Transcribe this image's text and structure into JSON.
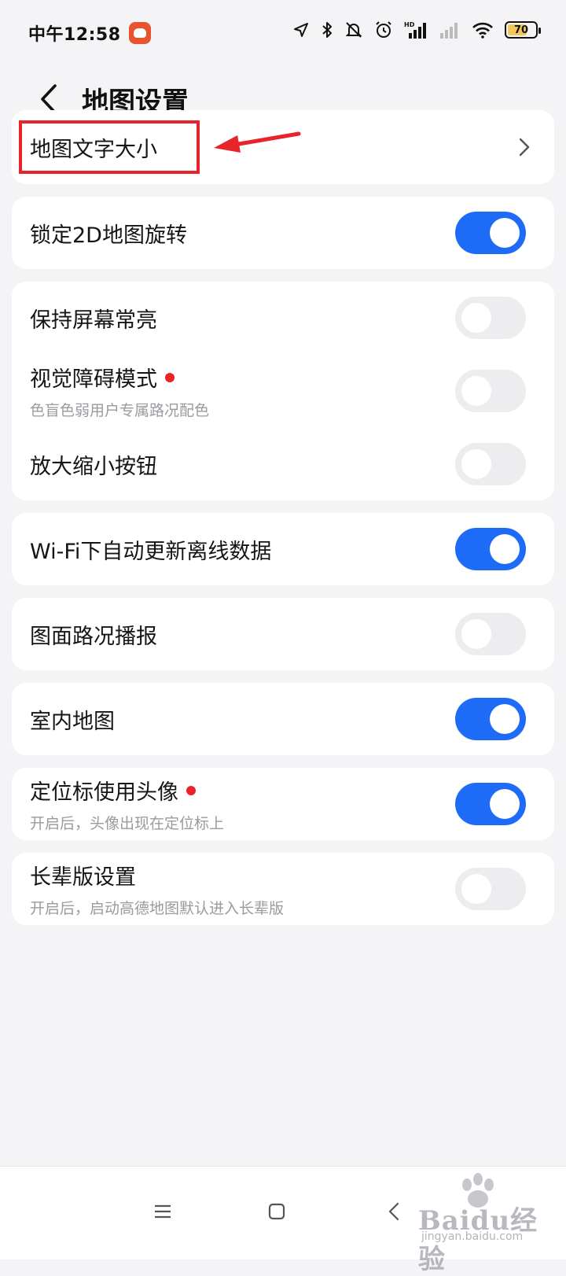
{
  "status_bar": {
    "time": "中午12:58",
    "battery": "70",
    "battery_level_percent": 70,
    "icons": [
      "location-icon",
      "bluetooth-icon",
      "mute-icon",
      "alarm-icon",
      "signal-hd-icon",
      "signal-icon",
      "wifi-icon",
      "battery-icon"
    ]
  },
  "header": {
    "title": "地图设置"
  },
  "settings": {
    "text_size": {
      "title": "地图文字大小"
    },
    "lock_2d": {
      "title": "锁定2D地图旋转",
      "enabled": true
    },
    "screen_on": {
      "title": "保持屏幕常亮",
      "enabled": false
    },
    "visual": {
      "title": "视觉障碍模式",
      "subtitle": "色盲色弱用户专属路况配色",
      "enabled": false
    },
    "zoom_buttons": {
      "title": "放大缩小按钮",
      "enabled": false
    },
    "wifi_update": {
      "title": "Wi-Fi下自动更新离线数据",
      "enabled": true
    },
    "traffic_broadcast": {
      "title": "图面路况播报",
      "enabled": false
    },
    "indoor_map": {
      "title": "室内地图",
      "enabled": true
    },
    "avatar_marker": {
      "title": "定位标使用头像",
      "subtitle": "开启后，头像出现在定位标上",
      "enabled": true
    },
    "elder_mode": {
      "title": "长辈版设置",
      "subtitle": "开启后，启动高德地图默认进入长辈版",
      "enabled": false
    }
  },
  "colors": {
    "accent": "#1e6bf7",
    "toggle_off": "#ededf0",
    "annotation_red": "#e8232a",
    "badge_red": "#f0202a"
  },
  "watermark": {
    "brand": "Baidu经验",
    "url": "jingyan.baidu.com"
  }
}
